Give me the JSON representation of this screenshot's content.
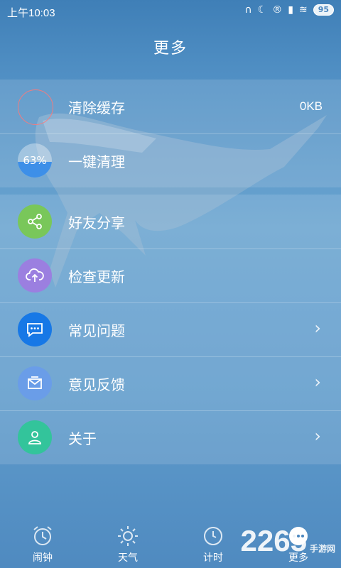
{
  "status_bar": {
    "time": "上午10:03",
    "battery": "95"
  },
  "header": {
    "title": "更多"
  },
  "menu": {
    "clear_cache": {
      "label": "清除缓存",
      "value": "0KB"
    },
    "one_key_clean": {
      "label": "一键清理",
      "percent": "63%"
    },
    "share": {
      "label": "好友分享"
    },
    "update": {
      "label": "检查更新"
    },
    "faq": {
      "label": "常见问题"
    },
    "feedback": {
      "label": "意见反馈"
    },
    "about": {
      "label": "关于"
    }
  },
  "tabs": [
    {
      "label": "闹钟",
      "icon": "alarm-clock-icon"
    },
    {
      "label": "天气",
      "icon": "sun-icon"
    },
    {
      "label": "计时",
      "icon": "timer-icon"
    },
    {
      "label": "更多",
      "icon": "more-icon"
    }
  ],
  "watermark": {
    "digits": "2265",
    "text": "手游网"
  },
  "colors": {
    "share_icon": "#79c75a",
    "update_icon": "#9b7fe0",
    "faq_icon": "#1778e6",
    "feedback_icon": "#6a9de8",
    "about_icon": "#33c49b",
    "clean_progress": "#3d8fe8"
  }
}
